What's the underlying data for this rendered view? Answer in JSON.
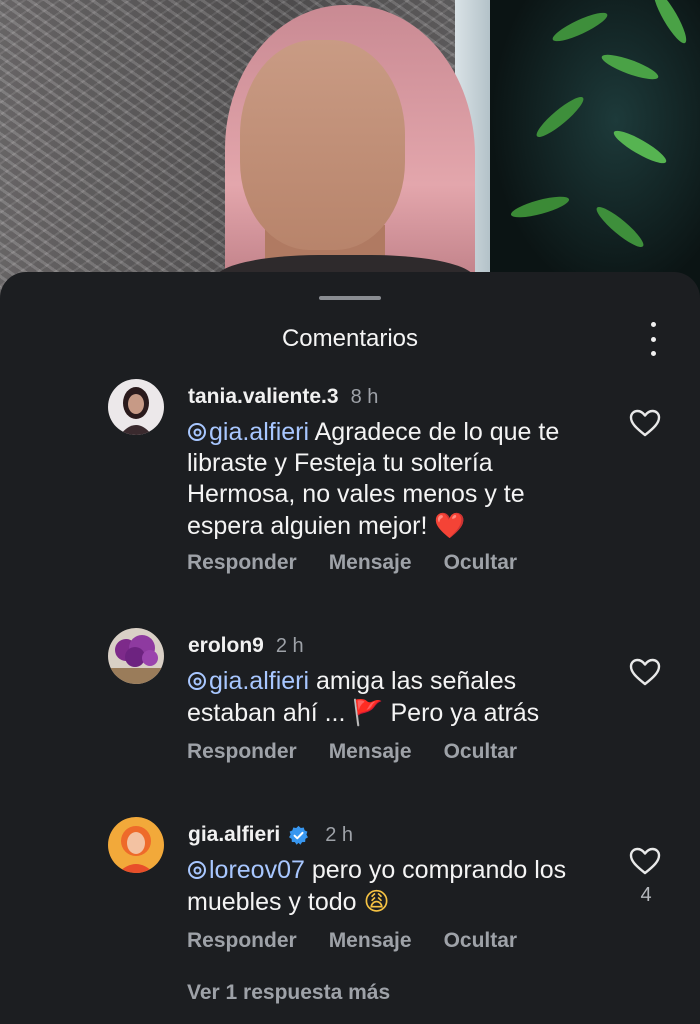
{
  "sheet": {
    "title": "Comentarios"
  },
  "comments": [
    {
      "username": "tania.valiente.3",
      "time": "8 h",
      "mention": "gia.alfieri",
      "text": " Agradece de lo que te libraste y Festeja tu soltería Hermosa, no vales menos y te espera alguien mejor! ",
      "emoji": "❤️",
      "actions": [
        "Responder",
        "Mensaje",
        "Ocultar"
      ]
    },
    {
      "username": "erolon9",
      "time": "2 h",
      "mention": "gia.alfieri",
      "text": " amiga las señales estaban ahí ... ",
      "emoji": "🚩",
      "text_after": " Pero ya atrás",
      "actions": [
        "Responder",
        "Mensaje",
        "Ocultar"
      ]
    },
    {
      "username": "gia.alfieri",
      "verified": true,
      "time": "2 h",
      "mention": "loreov07",
      "text": " pero yo comprando los muebles y todo ",
      "emoji": "😩",
      "likes": "4",
      "actions": [
        "Responder",
        "Mensaje",
        "Ocultar"
      ]
    }
  ],
  "more_replies": "Ver 1 respuesta más",
  "icons": {
    "heart": "heart-icon",
    "more": "more-vertical-icon",
    "verified": "verified-badge-icon",
    "mention": "threads-mention-icon"
  },
  "colors": {
    "background": "#1c1e21",
    "mention": "#a8c7ff",
    "verified": "#3897f0",
    "secondary_text": "#9ea2a8"
  }
}
